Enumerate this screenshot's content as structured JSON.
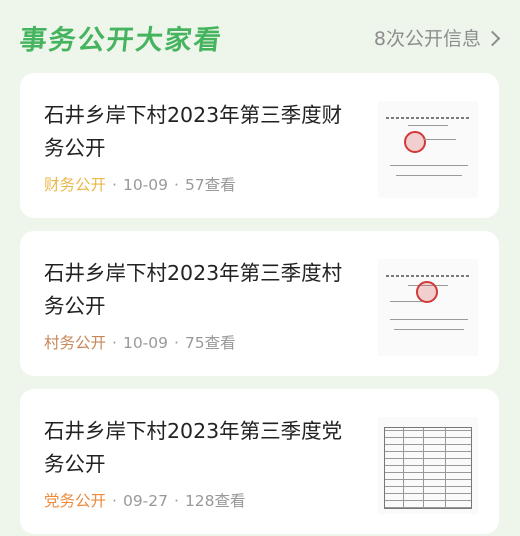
{
  "header": {
    "title": "事务公开大家看",
    "more_label": "8次公开信息"
  },
  "cards": [
    {
      "title": "石井乡岸下村2023年第三季度财务公开",
      "category": "财务公开",
      "date": "10-09",
      "views": "57查看",
      "thumbnail_icon": "finance-document-icon"
    },
    {
      "title": "石井乡岸下村2023年第三季度村务公开",
      "category": "村务公开",
      "date": "10-09",
      "views": "75查看",
      "thumbnail_icon": "village-document-icon"
    },
    {
      "title": "石井乡岸下村2023年第三季度党务公开",
      "category": "党务公开",
      "date": "09-27",
      "views": "128查看",
      "thumbnail_icon": "party-table-document-icon"
    }
  ],
  "separator": "·",
  "colors": {
    "title_green": "#46b45e",
    "finance": "#e9b84a",
    "village": "#c8875a",
    "party": "#ee8a3a"
  }
}
